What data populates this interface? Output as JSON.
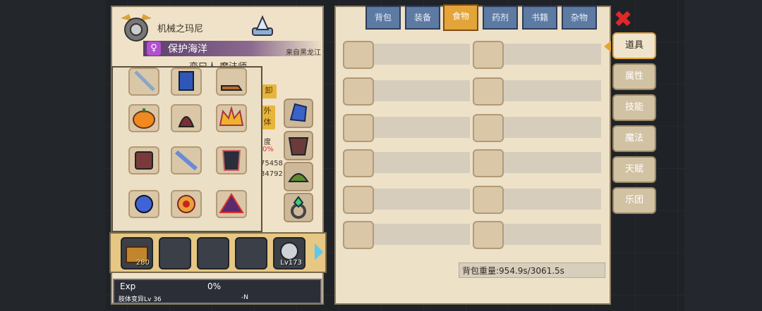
{
  "character": {
    "name": "机械之玛尼",
    "title": "保护海洋",
    "title_badge": "♀",
    "origin": "来自黑龙江",
    "subtitle": "恋曰人 魔法师",
    "side_labels": [
      "卸",
      "外",
      "体"
    ],
    "stats": [
      "度",
      "0%",
      "75458",
      "34792"
    ]
  },
  "bottom_bar": {
    "slot1_count": "280",
    "slot5_level": "Lv173"
  },
  "exp": {
    "label": "Exp",
    "value": "0%",
    "mutation": "肢体变异Lv 36",
    "right": "-N"
  },
  "inventory": {
    "tabs": [
      "背包",
      "装备",
      "食物",
      "药剂",
      "书籍",
      "杂物"
    ],
    "active_tab": "食物",
    "weight": "背包重量:954.9s/3061.5s"
  },
  "side_tabs": [
    "道具",
    "属性",
    "技能",
    "魔法",
    "天赋",
    "乐团"
  ],
  "close_symbol": "✖",
  "colors": {
    "accent": "#e3a43a",
    "tab_blue": "#5d7aa3",
    "close_red": "#e02828",
    "panel_bg": "#ede1c8"
  }
}
